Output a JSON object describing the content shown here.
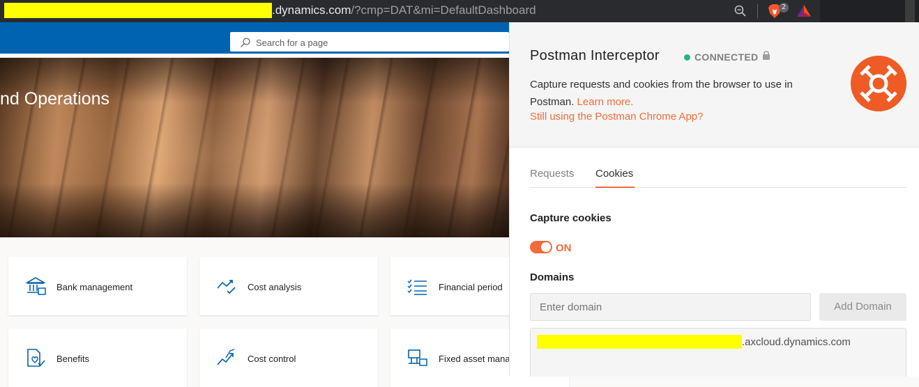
{
  "browser": {
    "url_host_suffix": ".dynamics.com",
    "url_path": "/?cmp=DAT&mi=DefaultDashboard",
    "brave_badge_count": "2",
    "icons": [
      "zoom-out-icon",
      "brave-lion-icon",
      "bat-triangle-icon"
    ]
  },
  "d365": {
    "search_placeholder": "Search for a page",
    "hero_title": "nd Operations",
    "tiles": [
      {
        "label": "Bank management",
        "icon": "bank-icon"
      },
      {
        "label": "Cost analysis",
        "icon": "trend-check-icon"
      },
      {
        "label": "Financial period",
        "icon": "checklist-icon"
      },
      {
        "label": "Benefits",
        "icon": "benefits-document-icon"
      },
      {
        "label": "Cost control",
        "icon": "trend-arrow-icon"
      },
      {
        "label": "Fixed asset mana",
        "icon": "fixed-asset-icon"
      }
    ],
    "colors": {
      "header": "#0063b1",
      "accent": "#0063b1"
    }
  },
  "postman": {
    "title": "Postman Interceptor",
    "status": "CONNECTED",
    "description": "Capture requests and cookies from the browser to use in Postman.",
    "learn_more": "Learn more.",
    "chrome_app_link": "Still using the Postman Chrome App?",
    "tabs": [
      {
        "label": "Requests",
        "active": false
      },
      {
        "label": "Cookies",
        "active": true
      }
    ],
    "capture_cookies_label": "Capture cookies",
    "toggle_state": "ON",
    "domains_label": "Domains",
    "domain_placeholder": "Enter domain",
    "add_domain_label": "Add Domain",
    "domains": [
      ".axcloud.dynamics.com"
    ],
    "colors": {
      "accent": "#f26b3a",
      "connected": "#26b47f",
      "logo": "#ef5b25"
    }
  }
}
